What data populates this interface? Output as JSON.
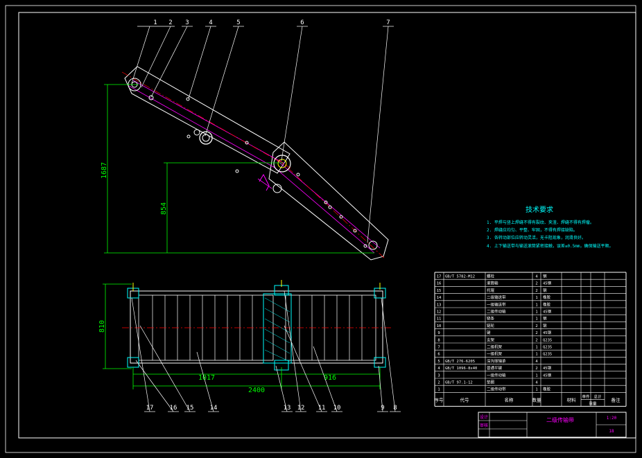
{
  "colors": {
    "background": "#000000",
    "frame": "#ffffff",
    "dimension": "#00ff00",
    "leader": "#ffffff",
    "tech": "#00ffff",
    "title": "#ff00ff",
    "centerline": "#ff0000",
    "magenta": "#ff00ff",
    "yellow": "#ffff00",
    "cyan": "#00ffff"
  },
  "dims": {
    "height_1": "1687",
    "height_2": "854",
    "frame_height": "810",
    "length_1": "1017",
    "length_2": "916",
    "length_total": "2400"
  },
  "callouts_top": [
    "1",
    "2",
    "3",
    "4",
    "5",
    "6",
    "7"
  ],
  "callouts_bottom": [
    "17",
    "16",
    "15",
    "14",
    "13",
    "12",
    "11",
    "10",
    "9",
    "8"
  ],
  "tech": {
    "title": "技术要求",
    "lines": [
      "1. 平焊与竖上焊缝不得有裂纹、夹渣、焊缝不得有焊瘤。",
      "2. 焊缝应均匀、平整、牢固，不得有焊接缺陷。",
      "3. 各转动部位应转动灵活，无卡阻现象，润滑良好。",
      "4. 上下输送带与输送滚筒紧密接触，误差≤0.5mm，确保输送平顺。"
    ]
  },
  "bom": {
    "rows": [
      {
        "no": "17",
        "code": "GB/T 5782-M12",
        "name": "螺栓",
        "qty": "4",
        "mat": "钢"
      },
      {
        "no": "16",
        "code": "",
        "name": "滚筒轴",
        "qty": "2",
        "mat": "45钢"
      },
      {
        "no": "15",
        "code": "",
        "name": "托辊",
        "qty": "2",
        "mat": "钢"
      },
      {
        "no": "14",
        "code": "",
        "name": "二级输送带",
        "qty": "1",
        "mat": "橡胶"
      },
      {
        "no": "13",
        "code": "",
        "name": "一级输送带",
        "qty": "1",
        "mat": "橡胶"
      },
      {
        "no": "12",
        "code": "",
        "name": "二级传动轴",
        "qty": "1",
        "mat": "45钢"
      },
      {
        "no": "11",
        "code": "",
        "name": "链条",
        "qty": "1",
        "mat": "钢"
      },
      {
        "no": "10",
        "code": "",
        "name": "链轮",
        "qty": "2",
        "mat": "钢"
      },
      {
        "no": "9",
        "code": "",
        "name": "键",
        "qty": "2",
        "mat": "45钢"
      },
      {
        "no": "8",
        "code": "",
        "name": "支架",
        "qty": "2",
        "mat": "Q235"
      },
      {
        "no": "7",
        "code": "",
        "name": "二级机架",
        "qty": "1",
        "mat": "Q235"
      },
      {
        "no": "6",
        "code": "",
        "name": "一级机架",
        "qty": "1",
        "mat": "Q235"
      },
      {
        "no": "5",
        "code": "GB/T 276-6205",
        "name": "深沟球轴承",
        "qty": "4",
        "mat": ""
      },
      {
        "no": "4",
        "code": "GB/T 1096-8x40",
        "name": "普通平键",
        "qty": "2",
        "mat": "45钢"
      },
      {
        "no": "3",
        "code": "",
        "name": "一级传动轴",
        "qty": "1",
        "mat": "45钢"
      },
      {
        "no": "2",
        "code": "GB/T 97.1-12",
        "name": "垫圈",
        "qty": "4",
        "mat": ""
      },
      {
        "no": "1",
        "code": "",
        "name": "二级传动带",
        "qty": "1",
        "mat": "橡胶"
      }
    ],
    "header": {
      "no": "序号",
      "code": "代号",
      "name": "名称",
      "qty": "数量",
      "mat": "材料",
      "unit": "单件",
      "total": "总计",
      "weight": "重量",
      "note": "备注"
    },
    "title": "二级传输带",
    "label_design": "设计",
    "label_check": "审核",
    "scale": "1:20",
    "sheet": "18"
  }
}
